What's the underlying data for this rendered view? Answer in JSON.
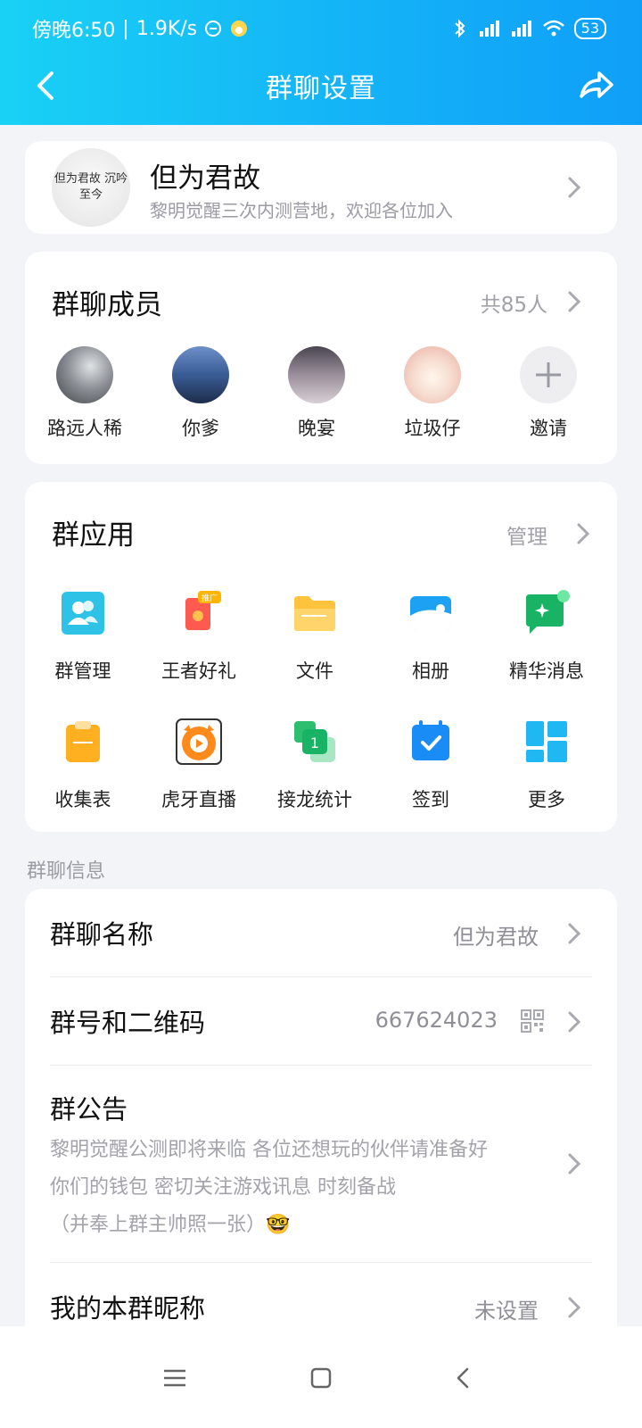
{
  "status_bar": {
    "time": "傍晚6:50",
    "speed": "1.9K/s",
    "battery": "53"
  },
  "nav": {
    "title": "群聊设置"
  },
  "group": {
    "avatar_text": "但为君故 沉吟至今",
    "name": "但为君故",
    "description": "黎明觉醒三次内测营地，欢迎各位加入"
  },
  "members": {
    "title": "群聊成员",
    "count": "共85人",
    "list": [
      {
        "name": "路远人稀"
      },
      {
        "name": "你爹"
      },
      {
        "name": "晚宴"
      },
      {
        "name": "垃圾仔"
      }
    ],
    "invite_label": "邀请"
  },
  "apps": {
    "title": "群应用",
    "manage": "管理",
    "items": [
      {
        "label": "群管理",
        "icon": "group-manage-icon"
      },
      {
        "label": "王者好礼",
        "icon": "gift-icon",
        "badge": "推广"
      },
      {
        "label": "文件",
        "icon": "folder-icon"
      },
      {
        "label": "相册",
        "icon": "album-icon"
      },
      {
        "label": "精华消息",
        "icon": "essence-message-icon"
      },
      {
        "label": "收集表",
        "icon": "clipboard-icon"
      },
      {
        "label": "虎牙直播",
        "icon": "huya-live-icon"
      },
      {
        "label": "接龙统计",
        "icon": "relay-count-icon"
      },
      {
        "label": "签到",
        "icon": "checkin-icon"
      },
      {
        "label": "更多",
        "icon": "more-grid-icon"
      }
    ]
  },
  "info": {
    "heading": "群聊信息",
    "name_row": {
      "title": "群聊名称",
      "value": "但为君故"
    },
    "number_row": {
      "title": "群号和二维码",
      "value": "667624023"
    },
    "notice_row": {
      "title": "群公告",
      "lines": [
        "黎明觉醒公测即将来临 各位还想玩的伙伴请准备好",
        "你们的钱包 密切关注游戏讯息 时刻备战",
        "（并奉上群主帅照一张）🤓"
      ]
    },
    "nickname_row": {
      "title": "我的本群昵称",
      "value": "未设置"
    }
  },
  "colors": {
    "header_start": "#19d1f5",
    "header_end": "#0f9ff8",
    "background": "#f3f4f8"
  }
}
